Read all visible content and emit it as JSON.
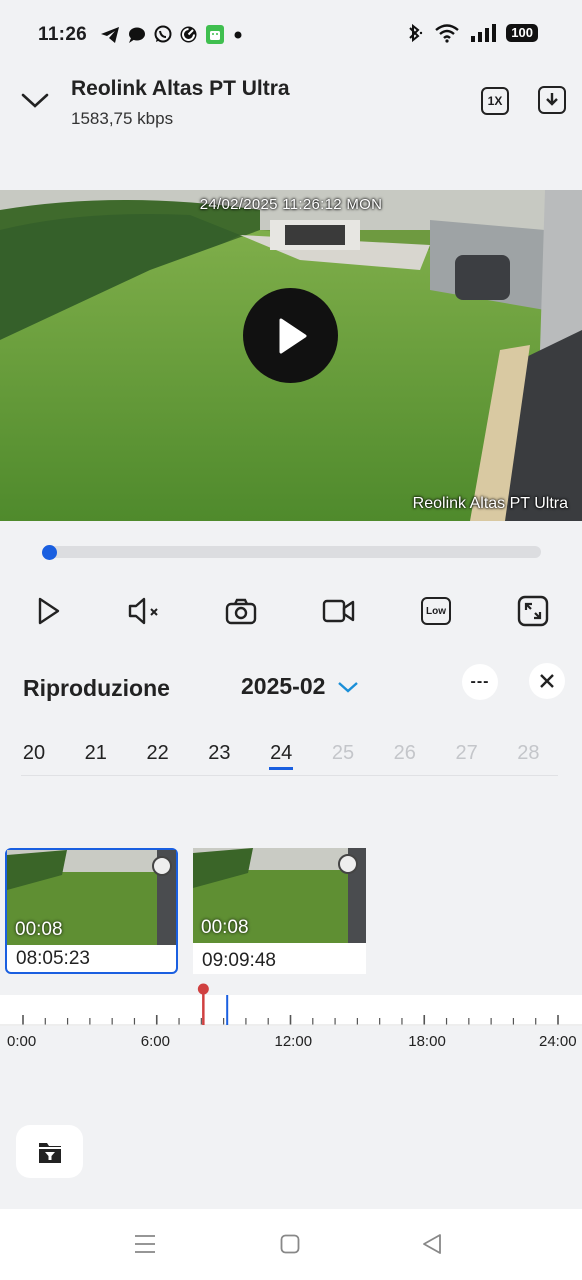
{
  "status_bar": {
    "time": "11:26",
    "battery": "100",
    "icons_left": [
      "telegram-icon",
      "chat-bubble-icon",
      "whatsapp-icon",
      "refresh-app-icon",
      "android-app-icon",
      "notification-dot"
    ],
    "icons_right": [
      "bluetooth-icon",
      "wifi-icon",
      "signal-icon",
      "battery-icon"
    ]
  },
  "header": {
    "title": "Reolink Altas PT Ultra",
    "bitrate": "1583,75 kbps",
    "speed_label": "1X"
  },
  "video": {
    "timestamp": "24/02/2025 11:26:12 MON",
    "camera_name": "Reolink Altas PT Ultra"
  },
  "progress": {
    "value": 0.0
  },
  "controls": [
    "play-icon",
    "mute-icon",
    "snapshot-icon",
    "record-icon",
    "quality-low-icon",
    "fullscreen-icon"
  ],
  "quality_label": "Low",
  "playback": {
    "title": "Riproduzione",
    "month": "2025-02",
    "more_label": "---"
  },
  "days": [
    {
      "label": "20",
      "active": true
    },
    {
      "label": "21",
      "active": true
    },
    {
      "label": "22",
      "active": true
    },
    {
      "label": "23",
      "active": true
    },
    {
      "label": "24",
      "active": true,
      "selected": true
    },
    {
      "label": "25",
      "active": false
    },
    {
      "label": "26",
      "active": false
    },
    {
      "label": "27",
      "active": false
    },
    {
      "label": "28",
      "active": false
    }
  ],
  "clips": [
    {
      "duration": "00:08",
      "time": "08:05:23",
      "selected": true
    },
    {
      "duration": "00:08",
      "time": "09:09:48",
      "selected": false
    }
  ],
  "timeline": {
    "labels": [
      "0:00",
      "6:00",
      "12:00",
      "18:00",
      "24:00"
    ],
    "marker_hours": [
      8.09,
      9.16
    ]
  },
  "colors": {
    "accent": "#1a5fe0",
    "marker_red": "#d04040",
    "background": "#f1f2f4"
  }
}
